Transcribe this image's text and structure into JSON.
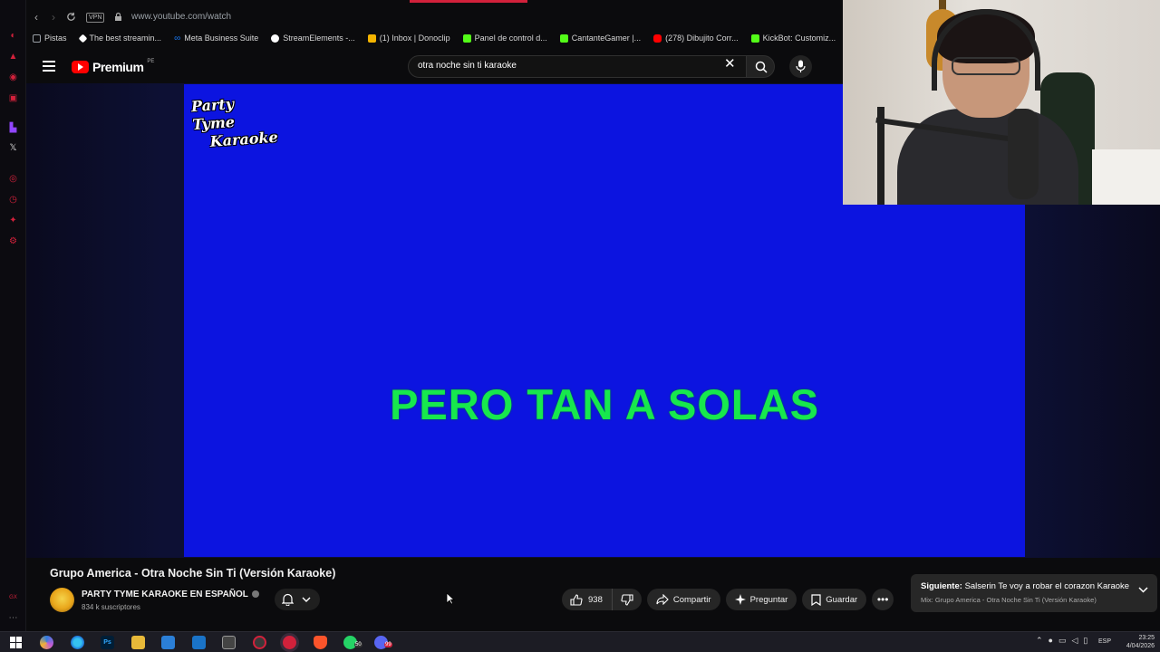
{
  "browser": {
    "url": "www.youtube.com/watch",
    "vpn_label": "VPN",
    "bookmarks": [
      {
        "label": "Pistas",
        "color": "#9aa0a6"
      },
      {
        "label": "The best streamin...",
        "color": "#ffffff"
      },
      {
        "label": "Meta Business Suite",
        "color": "#1877f2"
      },
      {
        "label": "StreamElements -...",
        "color": "#ffffff"
      },
      {
        "label": "(1) Inbox | Donoclip",
        "color": "#f4b400"
      },
      {
        "label": "Panel de control d...",
        "color": "#53fc18"
      },
      {
        "label": "CantanteGamer |...",
        "color": "#53fc18"
      },
      {
        "label": "(278) Dibujito Corr...",
        "color": "#ff0000"
      },
      {
        "label": "KickBot: Customiz...",
        "color": "#53fc18"
      }
    ]
  },
  "youtube": {
    "brand": "Premium",
    "region": "PE",
    "search_value": "otra noche sin ti karaoke"
  },
  "video": {
    "logo_line1": "Party Tyme",
    "logo_line2": "Karaoke",
    "lyrics": "PERO TAN A SOLAS",
    "title": "Grupo America - Otra Noche Sin Ti (Versión Karaoke)",
    "channel": "PARTY TYME KARAOKE EN ESPAÑOL",
    "subscribers": "834 k suscriptores",
    "likes": "938",
    "share_label": "Compartir",
    "ask_label": "Preguntar",
    "save_label": "Guardar"
  },
  "up_next": {
    "prefix": "Siguiente:",
    "title": "Salserin Te voy a robar el corazon Karaoke",
    "subtitle": "Mix: Grupo America - Otra Noche Sin Ti (Versión Karaoke)"
  },
  "taskbar": {
    "whatsapp_badge": "50",
    "discord_badge": "99",
    "language": "ESP",
    "time": "23:25",
    "date": "4/04/2026"
  },
  "colors": {
    "video_bg": "#0c14e0",
    "lyrics": "#17e84d",
    "yt_red": "#ff0000"
  }
}
